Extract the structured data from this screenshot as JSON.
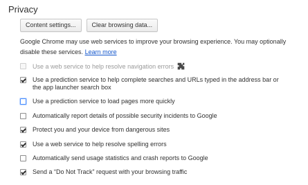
{
  "section": {
    "title": "Privacy"
  },
  "buttons": {
    "content_settings": "Content settings...",
    "clear_browsing_data": "Clear browsing data..."
  },
  "description": {
    "text": "Google Chrome may use web services to improve your browsing experience. You may optionally disable these services.",
    "learn_more": "Learn more"
  },
  "options": [
    {
      "label": "Use a web service to help resolve navigation errors",
      "checked": false,
      "disabled": true,
      "has_extension_icon": true,
      "extension_icon": "puzzle-piece-icon"
    },
    {
      "label": "Use a prediction service to help complete searches and URLs typed in the address bar or the app launcher search box",
      "checked": true,
      "disabled": false
    },
    {
      "label": "Use a prediction service to load pages more quickly",
      "checked": false,
      "disabled": false,
      "focused": true
    },
    {
      "label": "Automatically report details of possible security incidents to Google",
      "checked": false,
      "disabled": false
    },
    {
      "label": "Protect you and your device from dangerous sites",
      "checked": true,
      "disabled": false
    },
    {
      "label": "Use a web service to help resolve spelling errors",
      "checked": true,
      "disabled": false
    },
    {
      "label": "Automatically send usage statistics and crash reports to Google",
      "checked": false,
      "disabled": false
    },
    {
      "label": "Send a “Do Not Track” request with your browsing traffic",
      "checked": true,
      "disabled": false
    }
  ],
  "colors": {
    "link": "#1155cc",
    "text": "#303030",
    "disabled_text": "#9a9a9a",
    "focus_ring": "#4d90fe"
  }
}
